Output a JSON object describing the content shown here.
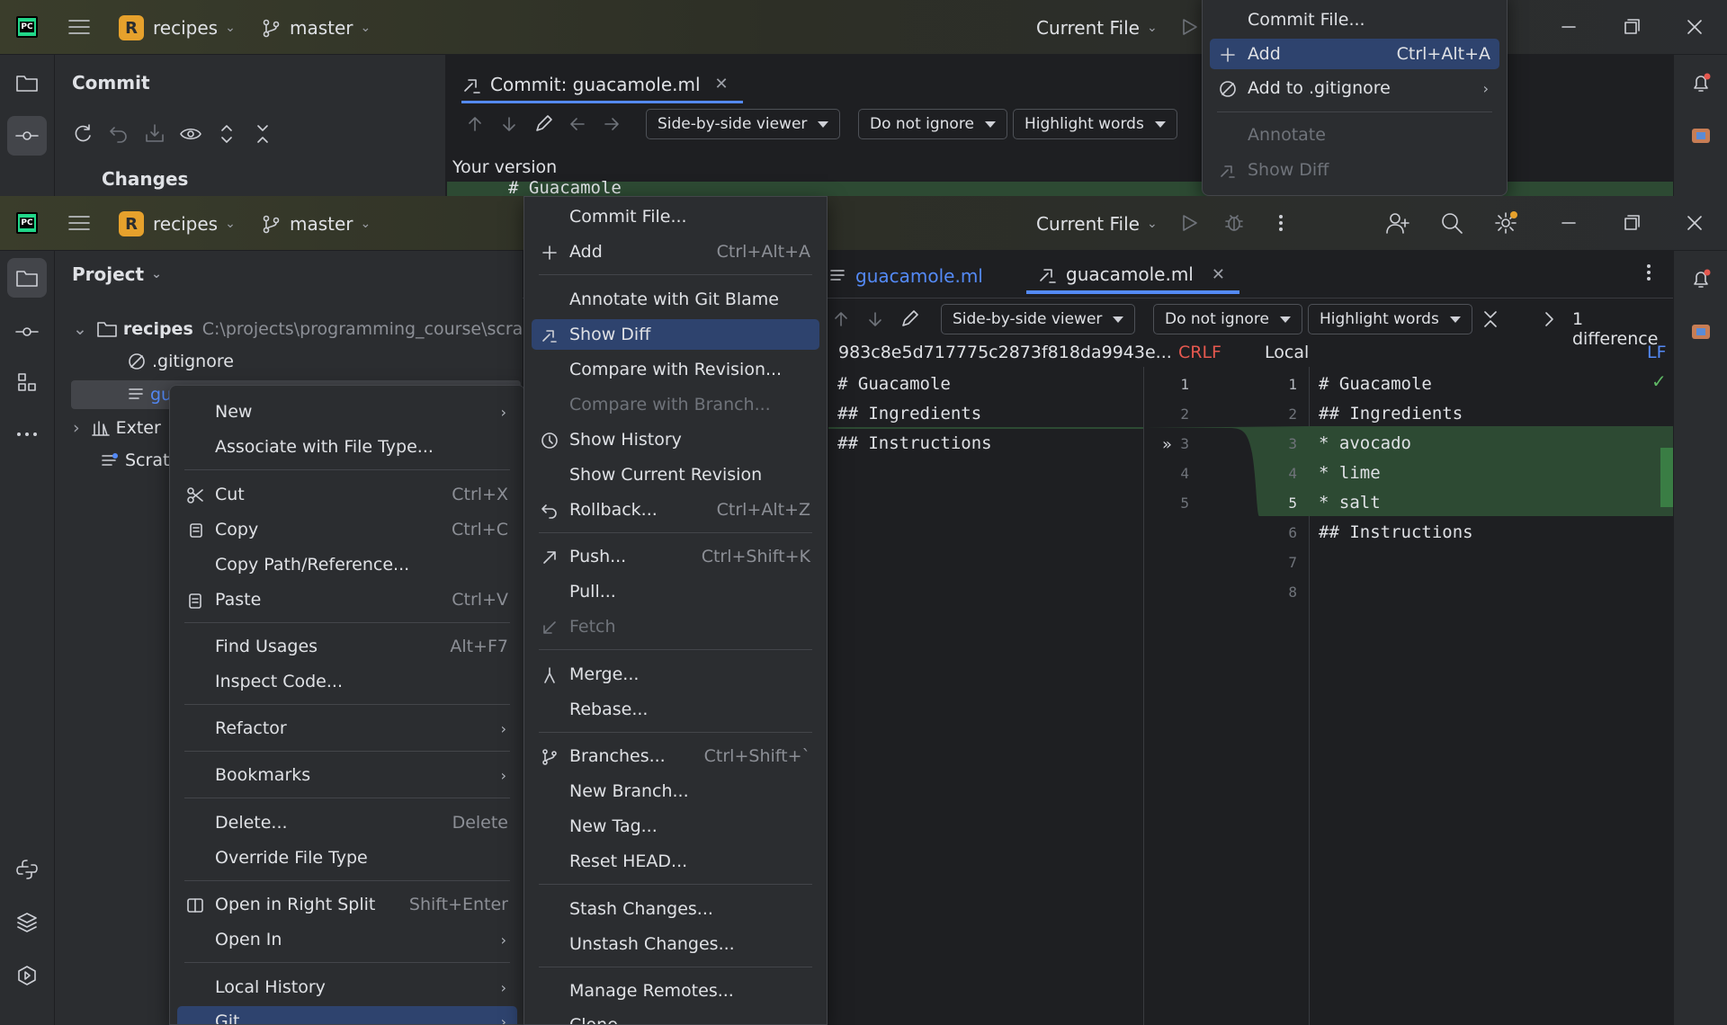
{
  "top_window": {
    "project_name": "recipes",
    "project_initial": "R",
    "branch": "master",
    "run_config": "Current File",
    "panel_title": "Commit",
    "changes_label": "Changes",
    "tab_title": "Commit: guacamole.ml",
    "viewer_mode": "Side-by-side viewer",
    "ignore_mode": "Do not ignore",
    "highlight_mode": "Highlight words",
    "your_version": "Your version",
    "code_peek": "# Guacamole"
  },
  "top_menu": {
    "items": [
      {
        "label": "Commit File...",
        "shortcut": ""
      },
      {
        "label": "Add",
        "shortcut": "Ctrl+Alt+A"
      },
      {
        "label": "Add to .gitignore",
        "shortcut": ""
      },
      {
        "label": "Annotate",
        "shortcut": ""
      },
      {
        "label": "Show Diff",
        "shortcut": ""
      }
    ]
  },
  "main_window": {
    "project_name": "recipes",
    "project_initial": "R",
    "branch": "master",
    "run_config": "Current File",
    "panel_title": "Project",
    "tree": {
      "root_name": "recipes",
      "root_path": "C:\\projects\\programming_course\\scratch",
      "gitignore": ".gitignore",
      "selected_file": "gu",
      "external": "Exter",
      "scratches": "Scrat"
    },
    "tabs": [
      {
        "label": "guacamole.ml"
      },
      {
        "label": "guacamole.ml"
      }
    ],
    "diff_toolbar": {
      "viewer_mode": "Side-by-side viewer",
      "ignore_mode": "Do not ignore",
      "highlight_mode": "Highlight words",
      "differences": "1 difference"
    },
    "left_pane": {
      "revision": "983c8e5d717775c2873f818da9943e...",
      "line_sep": "CRLF",
      "lines": [
        "# Guacamole",
        "## Ingredients",
        "## Instructions"
      ],
      "line_numbers": [
        "1",
        "2",
        "3",
        "4",
        "5"
      ]
    },
    "right_pane": {
      "revision": "Local",
      "line_sep": "LF",
      "lines": [
        "# Guacamole",
        "## Ingredients",
        "* avocado",
        "* lime",
        "* salt",
        "## Instructions",
        "",
        ""
      ],
      "line_numbers": [
        "1",
        "2",
        "3",
        "4",
        "5",
        "6",
        "7",
        "8"
      ]
    }
  },
  "context_menu": {
    "items": [
      {
        "label": "New",
        "shortcut": ""
      },
      {
        "label": "Associate with File Type...",
        "shortcut": ""
      },
      {
        "label": "Cut",
        "shortcut": "Ctrl+X"
      },
      {
        "label": "Copy",
        "shortcut": "Ctrl+C"
      },
      {
        "label": "Copy Path/Reference...",
        "shortcut": ""
      },
      {
        "label": "Paste",
        "shortcut": "Ctrl+V"
      },
      {
        "label": "Find Usages",
        "shortcut": "Alt+F7"
      },
      {
        "label": "Inspect Code...",
        "shortcut": ""
      },
      {
        "label": "Refactor",
        "shortcut": ""
      },
      {
        "label": "Bookmarks",
        "shortcut": ""
      },
      {
        "label": "Delete...",
        "shortcut": "Delete"
      },
      {
        "label": "Override File Type",
        "shortcut": ""
      },
      {
        "label": "Open in Right Split",
        "shortcut": "Shift+Enter"
      },
      {
        "label": "Open In",
        "shortcut": ""
      },
      {
        "label": "Local History",
        "shortcut": ""
      },
      {
        "label": "Git",
        "shortcut": ""
      }
    ]
  },
  "git_menu": {
    "items": [
      {
        "label": "Commit File...",
        "shortcut": ""
      },
      {
        "label": "Add",
        "shortcut": "Ctrl+Alt+A"
      },
      {
        "label": "Annotate with Git Blame",
        "shortcut": ""
      },
      {
        "label": "Show Diff",
        "shortcut": ""
      },
      {
        "label": "Compare with Revision...",
        "shortcut": ""
      },
      {
        "label": "Compare with Branch...",
        "shortcut": ""
      },
      {
        "label": "Show History",
        "shortcut": ""
      },
      {
        "label": "Show Current Revision",
        "shortcut": ""
      },
      {
        "label": "Rollback...",
        "shortcut": "Ctrl+Alt+Z"
      },
      {
        "label": "Push...",
        "shortcut": "Ctrl+Shift+K"
      },
      {
        "label": "Pull...",
        "shortcut": ""
      },
      {
        "label": "Fetch",
        "shortcut": ""
      },
      {
        "label": "Merge...",
        "shortcut": ""
      },
      {
        "label": "Rebase...",
        "shortcut": ""
      },
      {
        "label": "Branches...",
        "shortcut": "Ctrl+Shift+`"
      },
      {
        "label": "New Branch...",
        "shortcut": ""
      },
      {
        "label": "New Tag...",
        "shortcut": ""
      },
      {
        "label": "Reset HEAD...",
        "shortcut": ""
      },
      {
        "label": "Stash Changes...",
        "shortcut": ""
      },
      {
        "label": "Unstash Changes...",
        "shortcut": ""
      },
      {
        "label": "Manage Remotes...",
        "shortcut": ""
      },
      {
        "label": "Clone...",
        "shortcut": ""
      }
    ]
  },
  "colors": {
    "accent": "#2e436e",
    "added_bg": "#2d4a33",
    "logo_green": "#21d789",
    "project_badge": "#e6a12c",
    "crlf": "#e5584f",
    "link_blue": "#548af7"
  }
}
